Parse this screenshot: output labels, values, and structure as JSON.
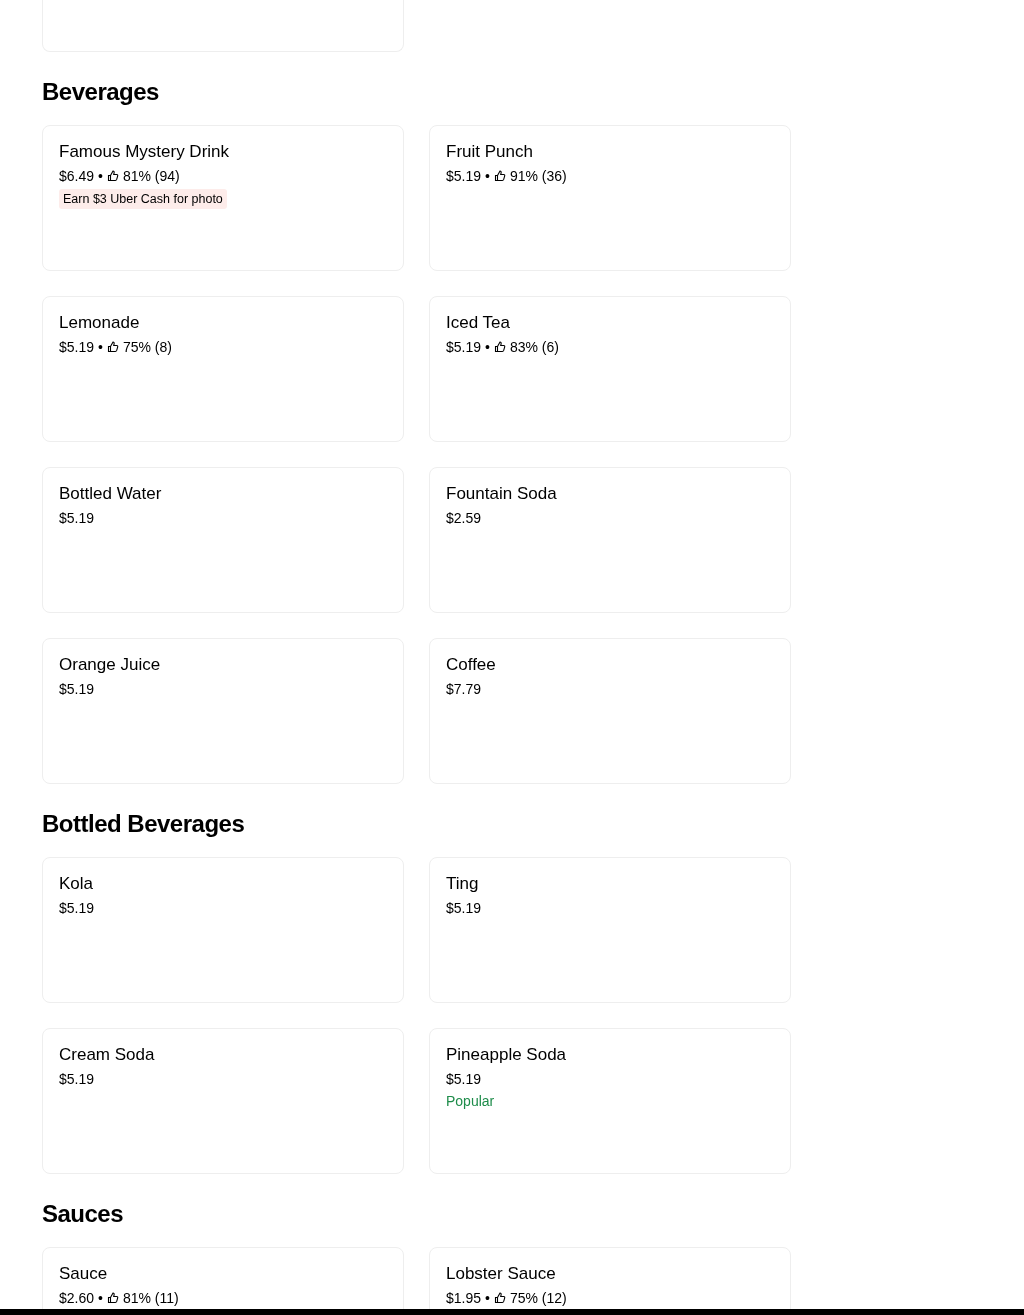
{
  "top_card_cut": true,
  "sections": [
    {
      "title": "Beverages",
      "items": [
        {
          "name": "Famous Mystery Drink",
          "price": "$6.49",
          "separator": "•",
          "rating": "81% (94)",
          "promo": "Earn $3 Uber Cash for photo"
        },
        {
          "name": "Fruit Punch",
          "price": "$5.19",
          "separator": "•",
          "rating": "91% (36)"
        },
        {
          "name": "Lemonade",
          "price": "$5.19",
          "separator": "•",
          "rating": "75% (8)"
        },
        {
          "name": "Iced Tea",
          "price": "$5.19",
          "separator": "•",
          "rating": "83% (6)"
        },
        {
          "name": "Bottled Water",
          "price": "$5.19"
        },
        {
          "name": "Fountain Soda",
          "price": "$2.59"
        },
        {
          "name": "Orange Juice",
          "price": "$5.19"
        },
        {
          "name": "Coffee",
          "price": "$7.79"
        }
      ]
    },
    {
      "title": "Bottled Beverages",
      "items": [
        {
          "name": "Kola",
          "price": "$5.19"
        },
        {
          "name": "Ting",
          "price": "$5.19"
        },
        {
          "name": "Cream Soda",
          "price": "$5.19"
        },
        {
          "name": "Pineapple Soda",
          "price": "$5.19",
          "tag": "Popular"
        }
      ]
    },
    {
      "title": "Sauces",
      "items": [
        {
          "name": "Sauce",
          "price": "$2.60",
          "separator": "•",
          "rating": "81% (11)"
        },
        {
          "name": "Lobster Sauce",
          "price": "$1.95",
          "separator": "•",
          "rating": "75% (12)"
        }
      ]
    }
  ]
}
